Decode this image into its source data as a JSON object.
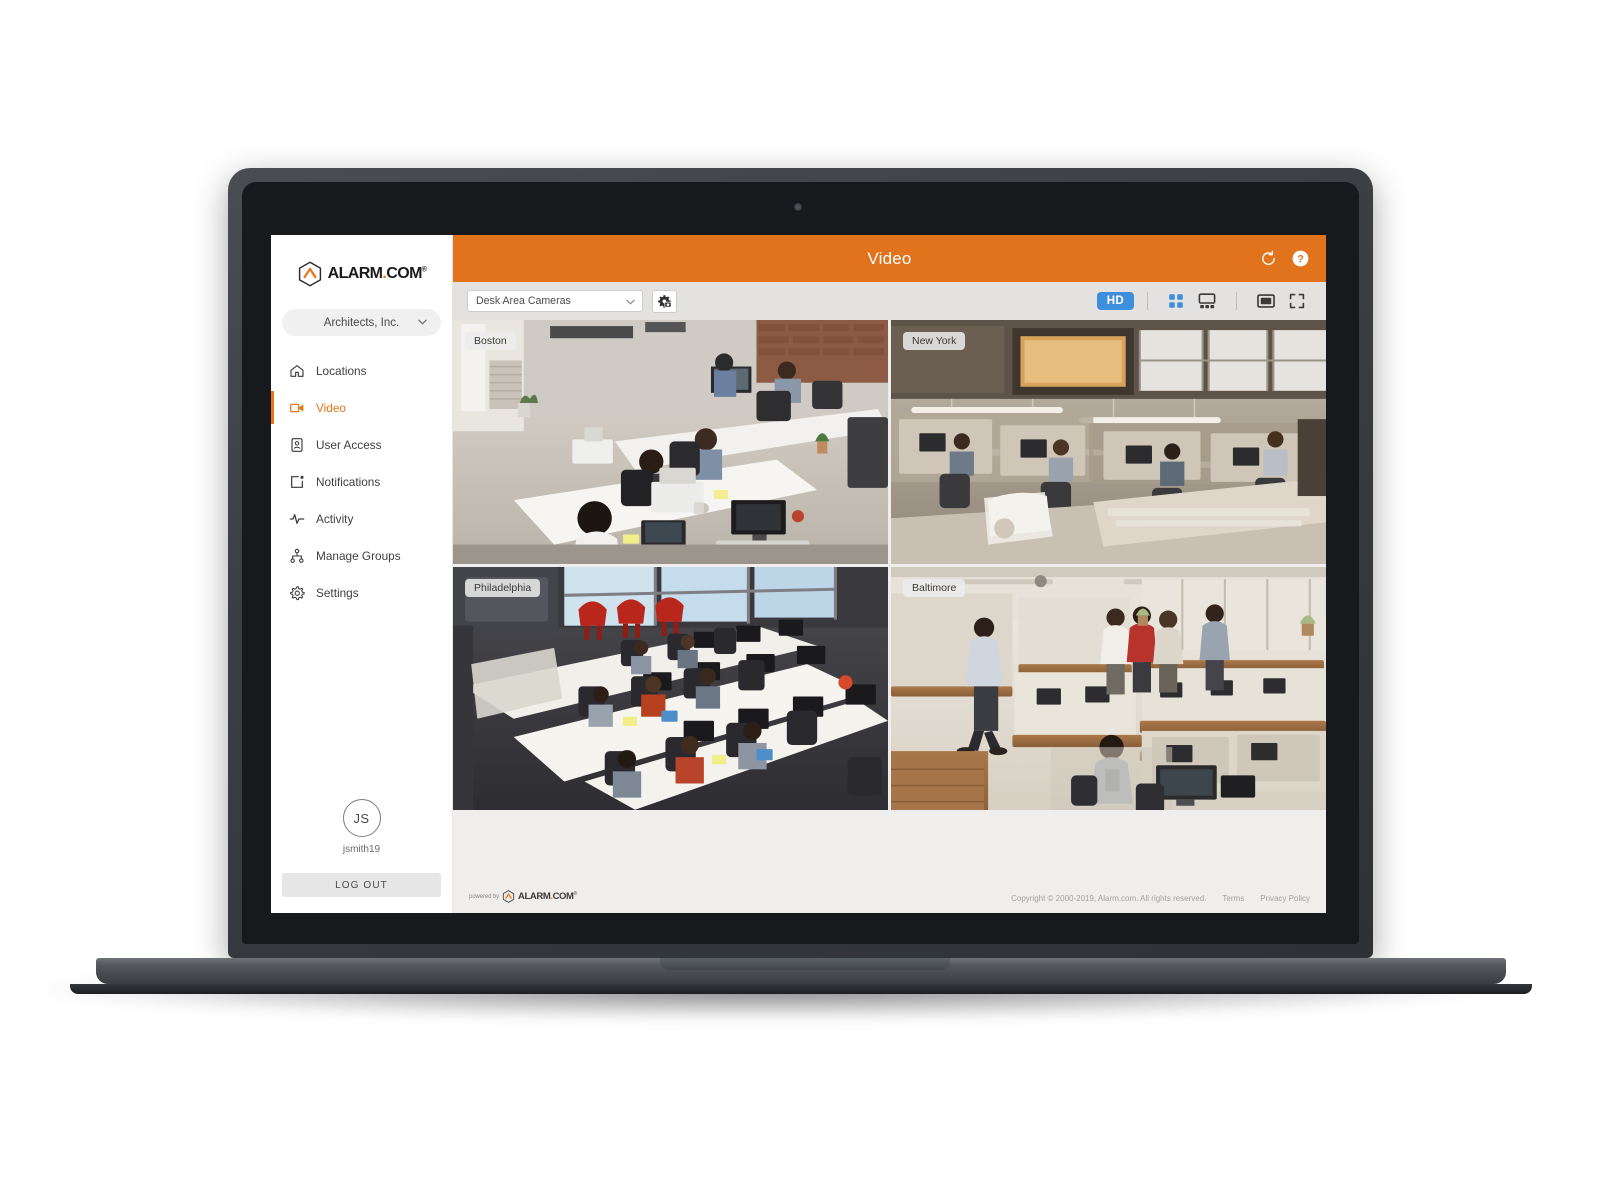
{
  "brand": {
    "name_part1": "ALARM",
    "dot": ".",
    "name_part2": "COM",
    "registered": "®",
    "logo_icon": "alarm-hexagon-logo"
  },
  "sidebar": {
    "account_selector": {
      "label": "Architects, Inc.",
      "chevron_icon": "chevron-down-icon"
    },
    "items": [
      {
        "label": "Locations",
        "icon": "home-icon",
        "active": false
      },
      {
        "label": "Video",
        "icon": "video-camera-icon",
        "active": true
      },
      {
        "label": "User Access",
        "icon": "id-badge-icon",
        "active": false
      },
      {
        "label": "Notifications",
        "icon": "bell-alert-icon",
        "active": false
      },
      {
        "label": "Activity",
        "icon": "pulse-icon",
        "active": false
      },
      {
        "label": "Manage Groups",
        "icon": "org-tree-icon",
        "active": false
      },
      {
        "label": "Settings",
        "icon": "gear-icon",
        "active": false
      }
    ],
    "user": {
      "initials": "JS",
      "username": "jsmith19",
      "avatar_icon": "avatar-initials"
    },
    "logout_label": "LOG OUT"
  },
  "header": {
    "title": "Video",
    "refresh_icon": "refresh-icon",
    "help_icon": "help-circle-icon",
    "background_color": "#e1731c"
  },
  "toolbar": {
    "camera_group_select": {
      "value": "Desk Area Cameras",
      "placeholder": "Select camera group",
      "chevron_icon": "chevron-down-icon"
    },
    "camera_settings_icon": "camera-settings-icon",
    "quality_badge": {
      "label": "HD",
      "active": true,
      "color": "#3d8fdd"
    },
    "view_modes": [
      {
        "name": "grid-four-view-icon",
        "active": true
      },
      {
        "name": "grid-one-plus-three-icon",
        "active": false
      }
    ],
    "display_controls": [
      {
        "name": "single-view-icon",
        "active": false
      },
      {
        "name": "fullscreen-icon",
        "active": false
      }
    ]
  },
  "cameras": [
    {
      "label": "Boston",
      "scene": "open-office-desks-daylight"
    },
    {
      "label": "New York",
      "scene": "cubicle-office-warm-lights"
    },
    {
      "label": "Philadelphia",
      "scene": "long-desk-rows-dark-floor"
    },
    {
      "label": "Baltimore",
      "scene": "open-plan-wood-partitions"
    }
  ],
  "footer": {
    "powered_by": "powered by",
    "copyright": "Copyright © 2000-2019, Alarm.com. All rights reserved.",
    "links": [
      {
        "label": "Terms"
      },
      {
        "label": "Privacy Policy"
      }
    ]
  }
}
